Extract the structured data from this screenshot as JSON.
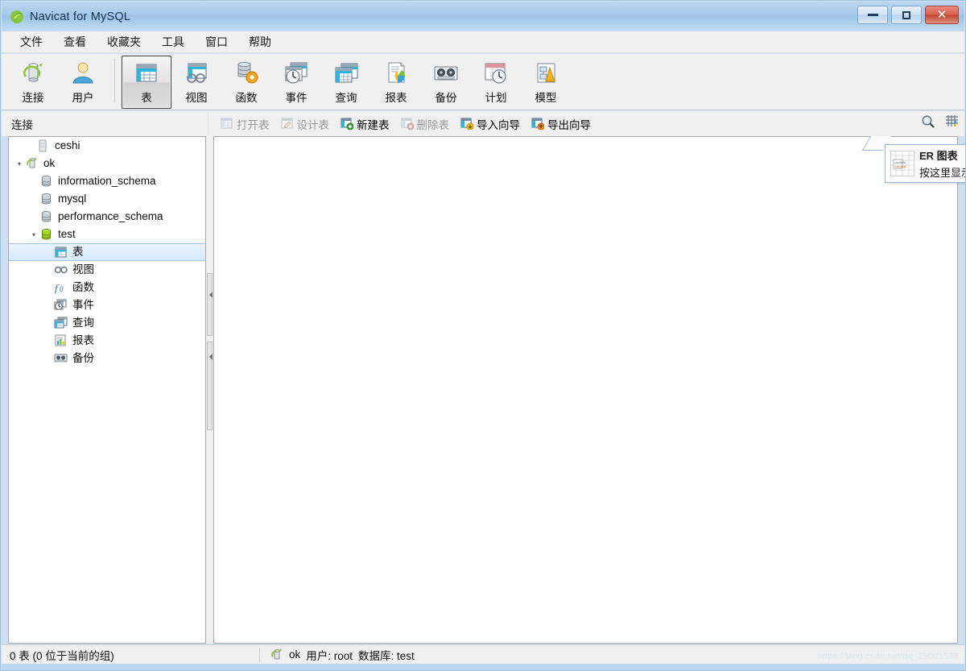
{
  "window": {
    "title": "Navicat for MySQL",
    "app_icon": "navicat-leaf-icon",
    "minimize_label": "最小化",
    "maximize_label": "最大化",
    "close_label": "关闭",
    "accent": "#a8c9e8"
  },
  "menubar": {
    "items": [
      {
        "label": "文件",
        "name": "menu-file"
      },
      {
        "label": "查看",
        "name": "menu-view"
      },
      {
        "label": "收藏夹",
        "name": "menu-favorites"
      },
      {
        "label": "工具",
        "name": "menu-tools"
      },
      {
        "label": "窗口",
        "name": "menu-window"
      },
      {
        "label": "帮助",
        "name": "menu-help"
      }
    ]
  },
  "toolbar": {
    "groups": [
      {
        "buttons": [
          {
            "label": "连接",
            "icon": "connection-icon",
            "active": false
          },
          {
            "label": "用户",
            "icon": "user-icon",
            "active": false
          }
        ]
      },
      {
        "buttons": [
          {
            "label": "表",
            "icon": "table-icon",
            "active": true
          },
          {
            "label": "视图",
            "icon": "view-icon",
            "active": false
          },
          {
            "label": "函数",
            "icon": "function-icon",
            "active": false
          },
          {
            "label": "事件",
            "icon": "event-icon",
            "active": false
          },
          {
            "label": "查询",
            "icon": "query-icon",
            "active": false
          },
          {
            "label": "报表",
            "icon": "report-icon",
            "active": false
          },
          {
            "label": "备份",
            "icon": "backup-icon",
            "active": false
          },
          {
            "label": "计划",
            "icon": "schedule-icon",
            "active": false
          },
          {
            "label": "模型",
            "icon": "model-icon",
            "active": false
          }
        ]
      }
    ]
  },
  "sidebar": {
    "header": "连接",
    "tree": [
      {
        "label": "ceshi",
        "indent": 1,
        "twisty": "",
        "icon": "server-gray-icon",
        "selected": false
      },
      {
        "label": "ok",
        "indent": 0,
        "twisty": "▾",
        "icon": "connection-icon",
        "selected": false
      },
      {
        "label": "information_schema",
        "indent": 1,
        "twisty": "",
        "icon": "database-gray-icon",
        "selected": false
      },
      {
        "label": "mysql",
        "indent": 1,
        "twisty": "",
        "icon": "database-gray-icon",
        "selected": false
      },
      {
        "label": "performance_schema",
        "indent": 1,
        "twisty": "",
        "icon": "database-gray-icon",
        "selected": false
      },
      {
        "label": "test",
        "indent": 1,
        "twisty": "▾",
        "icon": "database-green-icon",
        "selected": false
      },
      {
        "label": "表",
        "indent": 2,
        "twisty": "",
        "icon": "table-icon",
        "selected": true
      },
      {
        "label": "视图",
        "indent": 2,
        "twisty": "",
        "icon": "view-icon",
        "selected": false
      },
      {
        "label": "函数",
        "indent": 2,
        "twisty": "",
        "icon": "function-icon",
        "selected": false
      },
      {
        "label": "事件",
        "indent": 2,
        "twisty": "",
        "icon": "event-icon",
        "selected": false
      },
      {
        "label": "查询",
        "indent": 2,
        "twisty": "",
        "icon": "query-icon",
        "selected": false
      },
      {
        "label": "报表",
        "indent": 2,
        "twisty": "",
        "icon": "report-icon",
        "selected": false
      },
      {
        "label": "备份",
        "indent": 2,
        "twisty": "",
        "icon": "backup-icon",
        "selected": false
      }
    ]
  },
  "object_toolbar": {
    "buttons": [
      {
        "label": "打开表",
        "icon": "open-table-icon",
        "disabled": true
      },
      {
        "label": "设计表",
        "icon": "design-table-icon",
        "disabled": true
      },
      {
        "label": "新建表",
        "icon": "new-table-icon",
        "disabled": false
      },
      {
        "label": "删除表",
        "icon": "delete-table-icon",
        "disabled": true
      },
      {
        "label": "导入向导",
        "icon": "import-wizard-icon",
        "disabled": false
      },
      {
        "label": "导出向导",
        "icon": "export-wizard-icon",
        "disabled": false
      }
    ],
    "right_icons": [
      {
        "name": "search-icon"
      },
      {
        "name": "grid-view-icon"
      }
    ]
  },
  "er_popup": {
    "title": "ER 图表",
    "subtitle": "按这里显示"
  },
  "statusbar": {
    "left": "0 表 (0 位于当前的组)",
    "connection_icon": "connection-icon",
    "connection": "ok",
    "user": "用户: root",
    "database": "数据库: test",
    "watermark": "https://blog.csdn.net/qq_29001538"
  }
}
